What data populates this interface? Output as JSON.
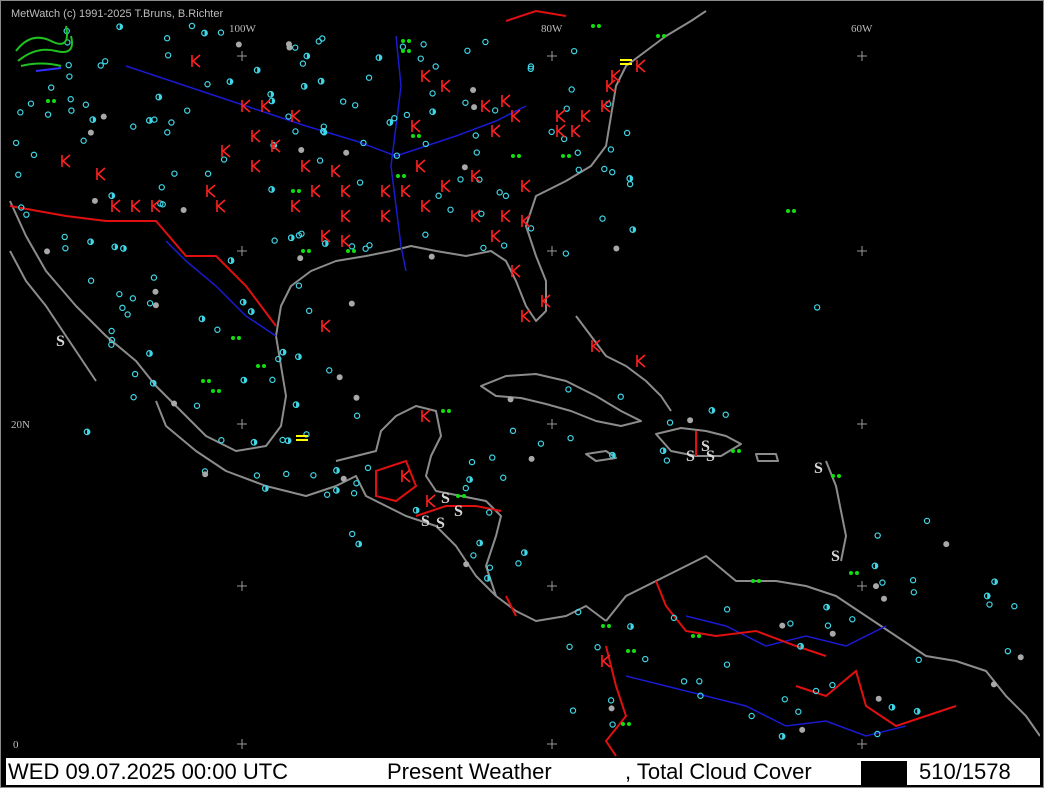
{
  "credit": "MetWatch  (c) 1991-2025 T.Bruns, B.Richter",
  "grid_labels": {
    "lon_100w": "100W",
    "lon_80w": "80W",
    "lon_60w": "60W",
    "lat_20n": "20N",
    "lat_0": "0"
  },
  "footer": {
    "datetime": "WED 09.07.2025 00:00 UTC",
    "product": "Present Weather",
    "secondary": ", Total Cloud Cover",
    "count": "510/1578"
  },
  "colors": {
    "background": "#000000",
    "coastline": "#8c8c8c",
    "rivers": "#1a1ad0",
    "borders": "#e01010",
    "station_clear": "#3fd6e6",
    "weather_thunder": "#ff2020",
    "weather_rain": "#10e010",
    "weather_fog": "#ffff00",
    "dust": "#c8c8c8"
  },
  "icons": {
    "logo": "metwatch-logo-icon",
    "grid_cross": "plus-icon",
    "thunderstorm": "thunderstorm-symbol-icon",
    "rain": "rain-symbol-icon",
    "clear_sky": "clear-circle-icon",
    "partly_cloudy": "half-circle-icon",
    "overcast": "filled-circle-icon"
  }
}
